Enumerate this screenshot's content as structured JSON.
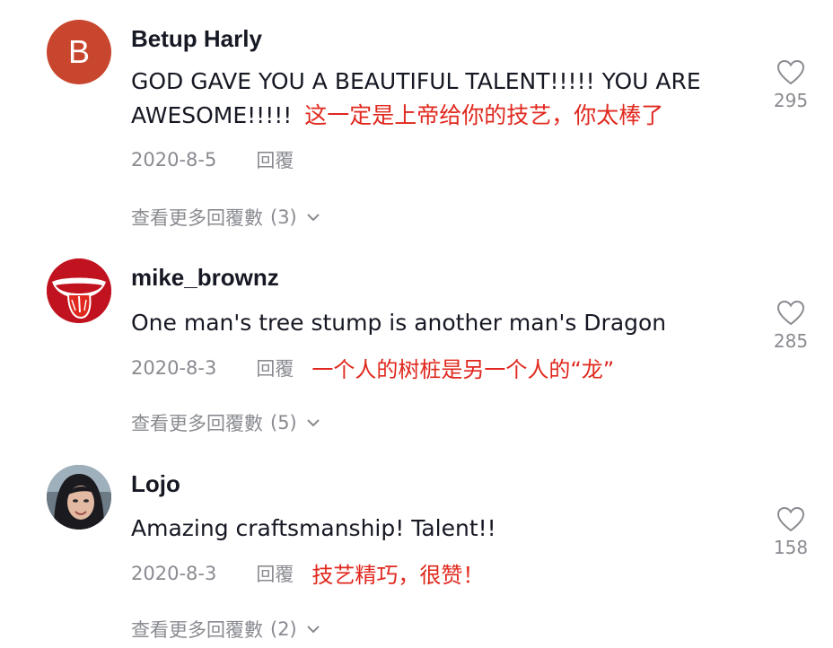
{
  "comments": [
    {
      "avatar_letter": "B",
      "username": "Betup Harly",
      "text": "GOD GAVE YOU A BEAUTIFUL TALENT!!!!! YOU ARE AWESOME!!!!!",
      "translation": "这一定是上帝给你的技艺，你太棒了",
      "date": "2020-8-5",
      "reply_label": "回覆",
      "more_replies_label": "查看更多回覆數",
      "more_replies_count": "(3)",
      "likes": "295"
    },
    {
      "username": "mike_brownz",
      "text": "One man's tree stump is another man's Dragon",
      "translation": "一个人的树桩是另一个人的“龙”",
      "date": "2020-8-3",
      "reply_label": "回覆",
      "more_replies_label": "查看更多回覆數",
      "more_replies_count": "(5)",
      "likes": "285"
    },
    {
      "username": "Lojo",
      "text": "Amazing craftsmanship! Talent!!",
      "translation": "技艺精巧，很赞！",
      "date": "2020-8-3",
      "reply_label": "回覆",
      "more_replies_label": "查看更多回覆數",
      "more_replies_count": "(2)",
      "likes": "158"
    }
  ],
  "colors": {
    "avatar_b": "#c8462e",
    "translation": "#e0281e",
    "meta_gray": "#8a8b91"
  },
  "icons": {
    "like": "heart-outline-icon",
    "expand": "chevron-down-icon"
  }
}
